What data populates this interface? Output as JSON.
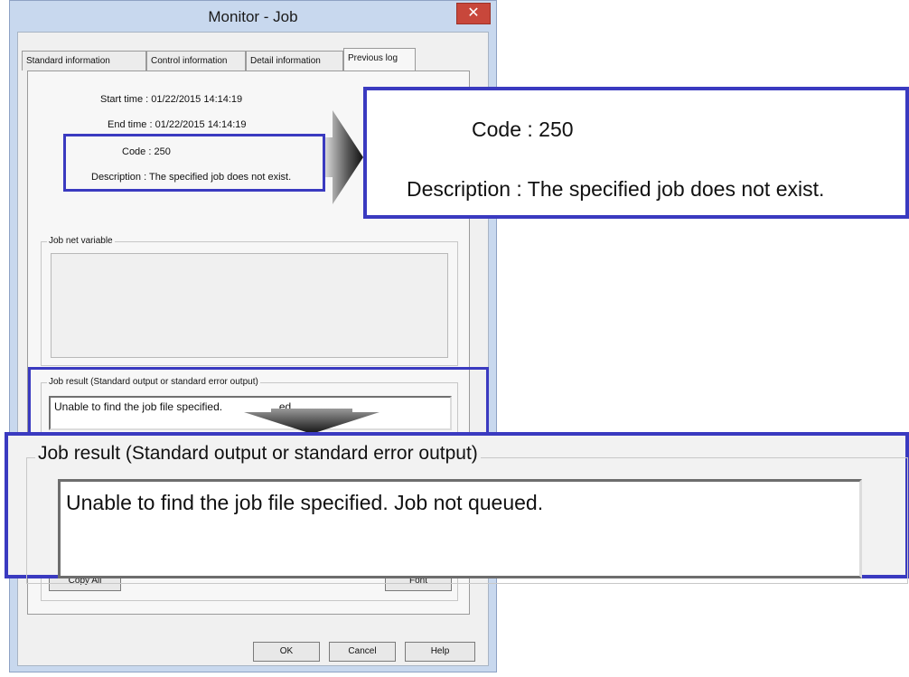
{
  "window": {
    "title": "Monitor - Job",
    "close_label": "✕"
  },
  "tabs": [
    {
      "label": "Standard information"
    },
    {
      "label": "Control information"
    },
    {
      "label": "Detail information"
    },
    {
      "label": "Previous log"
    }
  ],
  "log": {
    "start_time": "Start time : 01/22/2015 14:14:19",
    "end_time": "End time : 01/22/2015 14:14:19",
    "code": "Code : 250",
    "description": "Description : The specified job does not exist."
  },
  "jobnet_variable": {
    "label": "Job net variable"
  },
  "job_result": {
    "label": "Job result (Standard output or standard error output)",
    "text": "Unable to find the job file specified. Job not queued.",
    "text_partial_left": "Unable to find the job file specified.",
    "text_partial_right": "ed."
  },
  "buttons": {
    "copy_all": "Copy All",
    "font": "Font",
    "ok": "OK",
    "cancel": "Cancel",
    "help": "Help"
  },
  "colors": {
    "highlight": "#3a3ac0",
    "close_button": "#c8473b"
  },
  "icons": {
    "close": "close-icon",
    "arrow": "arrow-icon"
  }
}
